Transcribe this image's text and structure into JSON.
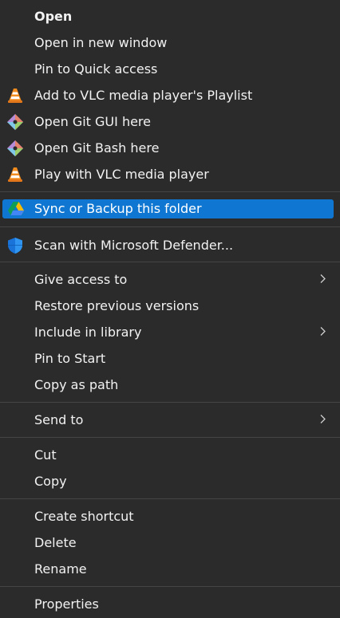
{
  "menu": {
    "group1": {
      "open": "Open",
      "open_new_window": "Open in new window",
      "pin_quick_access": "Pin to Quick access",
      "vlc_playlist": "Add to VLC media player's Playlist",
      "git_gui": "Open Git GUI here",
      "git_bash": "Open Git Bash here",
      "vlc_play": "Play with VLC media player"
    },
    "group2": {
      "sync_backup": "Sync or Backup this folder"
    },
    "group3": {
      "defender_scan": "Scan with Microsoft Defender..."
    },
    "group4": {
      "give_access": "Give access to",
      "restore_versions": "Restore previous versions",
      "include_library": "Include in library",
      "pin_start": "Pin to Start",
      "copy_path": "Copy as path"
    },
    "group5": {
      "send_to": "Send to"
    },
    "group6": {
      "cut": "Cut",
      "copy": "Copy"
    },
    "group7": {
      "create_shortcut": "Create shortcut",
      "delete": "Delete",
      "rename": "Rename"
    },
    "group8": {
      "properties": "Properties"
    }
  },
  "icons": {
    "vlc": "vlc-cone-icon",
    "git": "git-diamond-icon",
    "google_drive": "google-drive-icon",
    "defender": "defender-shield-icon",
    "submenu": "chevron-right-icon"
  },
  "colors": {
    "background": "#2b2b2b",
    "highlight": "#0f77d2",
    "separator": "#454545",
    "text": "#f2f2f2"
  }
}
